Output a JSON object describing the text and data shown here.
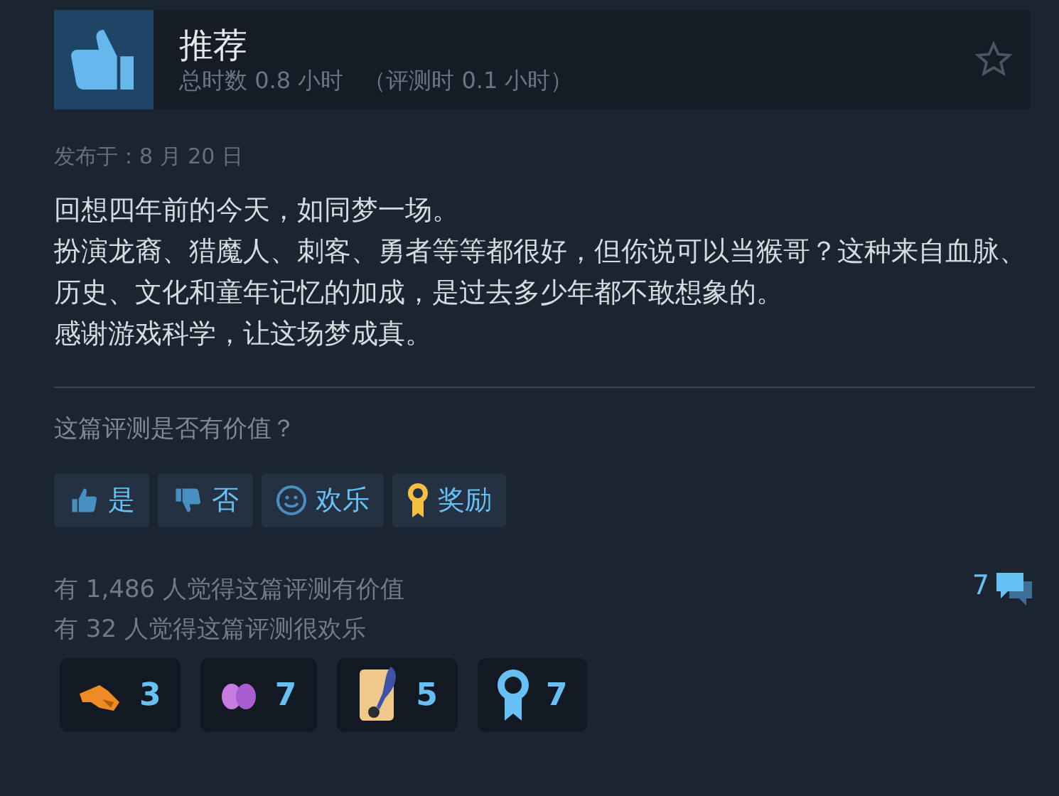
{
  "header": {
    "title": "推荐",
    "playtime": "总时数 0.8 小时",
    "playtime_at_review": "（评测时 0.1 小时）"
  },
  "posted": "发布于：8 月 20 日",
  "review_lines": [
    "回想四年前的今天，如同梦一场。",
    "扮演龙裔、猎魔人、刺客、勇者等等都很好，但你说可以当猴哥？这种来自血脉、历史、文化和童年记忆的加成，是过去多少年都不敢想象的。",
    "感谢游戏科学，让这场梦成真。"
  ],
  "question": "这篇评测是否有价值？",
  "vote_buttons": [
    {
      "kind": "up",
      "label": "是"
    },
    {
      "kind": "down",
      "label": "否"
    },
    {
      "kind": "funny",
      "label": "欢乐"
    },
    {
      "kind": "award",
      "label": "奖励"
    }
  ],
  "stats": [
    "有 1,486 人觉得这篇评测有价值",
    "有 32 人觉得这篇评测很欢乐"
  ],
  "comments_count": "7",
  "awards": [
    {
      "kind": "pointer",
      "count": "3"
    },
    {
      "kind": "hands",
      "count": "7"
    },
    {
      "kind": "scroll",
      "count": "5"
    },
    {
      "kind": "medal",
      "count": "7"
    }
  ]
}
